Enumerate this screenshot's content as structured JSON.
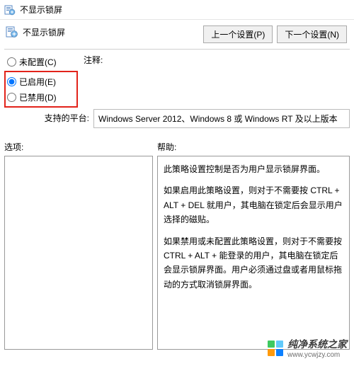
{
  "window": {
    "title": "不显示锁屏"
  },
  "header": {
    "title": "不显示锁屏",
    "prev_button": "上一个设置(P)",
    "next_button": "下一个设置(N)"
  },
  "config": {
    "not_configured": "未配置(C)",
    "enabled": "已启用(E)",
    "disabled": "已禁用(D)",
    "comment_label": "注释:"
  },
  "platform": {
    "label": "支持的平台:",
    "value": "Windows Server 2012、Windows 8 或 Windows RT 及以上版本"
  },
  "panes": {
    "options_label": "选项:",
    "help_label": "帮助:"
  },
  "help": {
    "p1": "此策略设置控制是否为用户显示锁屏界面。",
    "p2": "如果启用此策略设置，则对于不需要按 CTRL + ALT + DEL 就用户，其电脑在锁定后会显示用户选择的磁贴。",
    "p3": "如果禁用或未配置此策略设置，则对于不需要按 CTRL + ALT + 能登录的用户，其电脑在锁定后会显示锁屏界面。用户必须通过盘或者用鼠标拖动的方式取消锁屏界面。"
  },
  "watermark": {
    "line1": "纯净系统之家",
    "line2": "www.ycwjzy.com"
  }
}
